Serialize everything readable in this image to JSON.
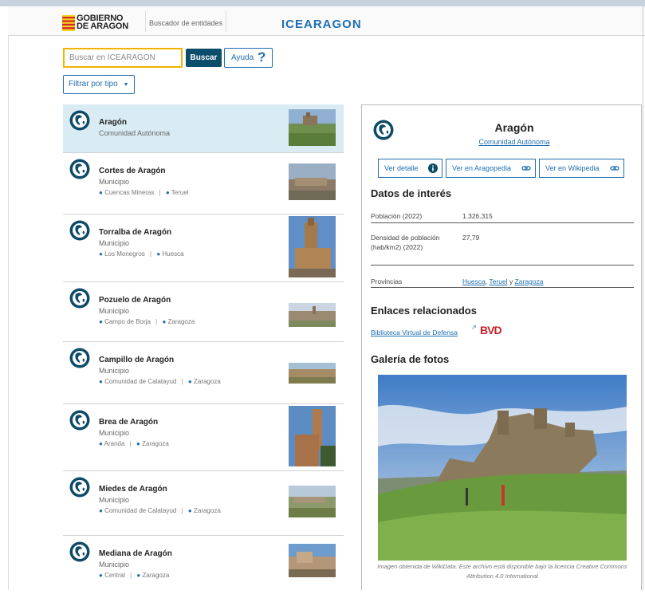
{
  "header": {
    "logo_line1": "GOBIERNO",
    "logo_line2": "DE ARAGON",
    "buscador_label": "Buscador de entidades",
    "brand": "ICEARAGON"
  },
  "search": {
    "placeholder": "Buscar en ICEARAGON",
    "button": "Buscar",
    "help": "Ayuda",
    "help_icon": "?",
    "filter": "Filtrar por tipo"
  },
  "results": [
    {
      "name": "Aragón",
      "type": "Comunidad Autónoma",
      "locations": []
    },
    {
      "name": "Cortes de Aragón",
      "type": "Municipio",
      "locations": [
        "Cuencas Mineras",
        "Teruel"
      ]
    },
    {
      "name": "Torralba de Aragón",
      "type": "Municipio",
      "locations": [
        "Los Monegros",
        "Huesca"
      ]
    },
    {
      "name": "Pozuelo de Aragón",
      "type": "Municipio",
      "locations": [
        "Campo de Borja",
        "Zaragoza"
      ]
    },
    {
      "name": "Campillo de Aragón",
      "type": "Municipio",
      "locations": [
        "Comunidad de Calatayud",
        "Zaragoza"
      ]
    },
    {
      "name": "Brea de Aragón",
      "type": "Municipio",
      "locations": [
        "Aranda",
        "Zaragoza"
      ]
    },
    {
      "name": "Miedes de Aragón",
      "type": "Municipio",
      "locations": [
        "Comunidad de Calatayud",
        "Zaragoza"
      ]
    },
    {
      "name": "Mediana de Aragón",
      "type": "Municipio",
      "locations": [
        "Central",
        "Zaragoza"
      ]
    }
  ],
  "detail": {
    "title": "Aragón",
    "subtitle": "Comunidad Autónoma",
    "btn_detalle": "Ver detalle",
    "btn_aragopedia": "Ver en Aragopedia",
    "btn_wikipedia": "Ver en Wikipedia",
    "datos_heading": "Datos de interés",
    "poblacion_label": "Población (2022)",
    "poblacion_value": "1.326.315",
    "densidad_label": "Densidad de población (hab/km2) (2022)",
    "densidad_value": "27,79",
    "provincias_label": "Provincias",
    "provincias": [
      "Huesca",
      "Teruel",
      "Zaragoza"
    ],
    "provincias_sep1": ",",
    "provincias_sep2": "y",
    "enlaces_heading": "Enlaces relacionados",
    "enlace": "Biblioteca Virtual de Defensa",
    "bvd_logo": "BVD",
    "galeria_heading": "Galería de fotos",
    "caption": "Imagen obtenida de WikiData. Este archivo está disponible bajo la licencia Creative Commons Attribution 4.0 International"
  },
  "colors": {
    "accent": "#1f6fb2",
    "dark_button": "#0b4d6b",
    "active_row": "#d9ecf4",
    "search_border": "#f2b400"
  }
}
